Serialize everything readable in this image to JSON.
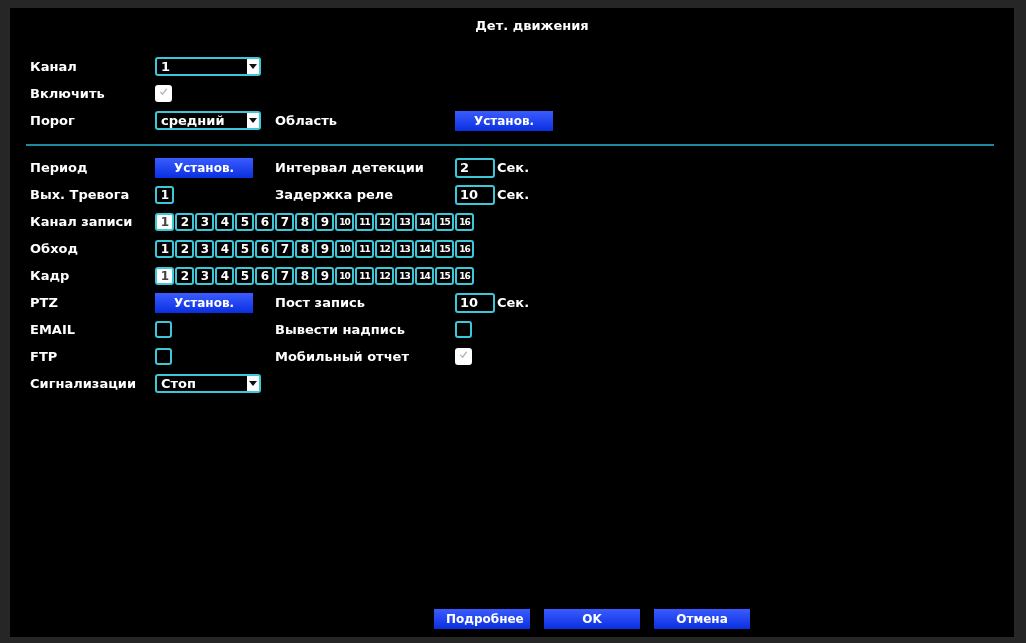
{
  "window": {
    "title": "Дет. движения"
  },
  "top_rows": [
    {
      "label": "Канал",
      "control": {
        "kind": "select",
        "value": "1"
      }
    },
    {
      "label": "Включить",
      "control": {
        "kind": "checkbox",
        "checked": true
      }
    },
    {
      "label": "Порог",
      "control": {
        "kind": "select",
        "value": "средний"
      },
      "right": {
        "label": "Область",
        "control": {
          "kind": "button",
          "label": "Установ."
        }
      }
    }
  ],
  "rows": [
    {
      "label": "Период",
      "control": {
        "kind": "button",
        "label": "Установ."
      },
      "right": {
        "label": "Интервал детекции",
        "control": {
          "kind": "number",
          "value": "2",
          "unit": "Сек."
        }
      }
    },
    {
      "label": "Вых. Тревога",
      "control": {
        "kind": "channels",
        "items": [
          {
            "label": "1",
            "selected": false
          }
        ]
      },
      "right": {
        "label": "Задержка реле",
        "control": {
          "kind": "number",
          "value": "10",
          "unit": "Сек."
        }
      }
    },
    {
      "label": "Канал записи",
      "control": {
        "kind": "channels",
        "items": [
          {
            "label": "1",
            "selected": true
          },
          {
            "label": "2",
            "selected": false
          },
          {
            "label": "3",
            "selected": false
          },
          {
            "label": "4",
            "selected": false
          },
          {
            "label": "5",
            "selected": false
          },
          {
            "label": "6",
            "selected": false
          },
          {
            "label": "7",
            "selected": false
          },
          {
            "label": "8",
            "selected": false
          },
          {
            "label": "9",
            "selected": false
          },
          {
            "label": "10",
            "selected": false
          },
          {
            "label": "11",
            "selected": false
          },
          {
            "label": "12",
            "selected": false
          },
          {
            "label": "13",
            "selected": false
          },
          {
            "label": "14",
            "selected": false
          },
          {
            "label": "15",
            "selected": false
          },
          {
            "label": "16",
            "selected": false
          }
        ]
      }
    },
    {
      "label": "Обход",
      "control": {
        "kind": "channels",
        "items": [
          {
            "label": "1",
            "selected": false
          },
          {
            "label": "2",
            "selected": false
          },
          {
            "label": "3",
            "selected": false
          },
          {
            "label": "4",
            "selected": false
          },
          {
            "label": "5",
            "selected": false
          },
          {
            "label": "6",
            "selected": false
          },
          {
            "label": "7",
            "selected": false
          },
          {
            "label": "8",
            "selected": false
          },
          {
            "label": "9",
            "selected": false
          },
          {
            "label": "10",
            "selected": false
          },
          {
            "label": "11",
            "selected": false
          },
          {
            "label": "12",
            "selected": false
          },
          {
            "label": "13",
            "selected": false
          },
          {
            "label": "14",
            "selected": false
          },
          {
            "label": "15",
            "selected": false
          },
          {
            "label": "16",
            "selected": false
          }
        ]
      }
    },
    {
      "label": "Кадр",
      "control": {
        "kind": "channels",
        "items": [
          {
            "label": "1",
            "selected": true
          },
          {
            "label": "2",
            "selected": false
          },
          {
            "label": "3",
            "selected": false
          },
          {
            "label": "4",
            "selected": false
          },
          {
            "label": "5",
            "selected": false
          },
          {
            "label": "6",
            "selected": false
          },
          {
            "label": "7",
            "selected": false
          },
          {
            "label": "8",
            "selected": false
          },
          {
            "label": "9",
            "selected": false
          },
          {
            "label": "10",
            "selected": false
          },
          {
            "label": "11",
            "selected": false
          },
          {
            "label": "12",
            "selected": false
          },
          {
            "label": "13",
            "selected": false
          },
          {
            "label": "14",
            "selected": false
          },
          {
            "label": "15",
            "selected": false
          },
          {
            "label": "16",
            "selected": false
          }
        ]
      }
    },
    {
      "label": "PTZ",
      "control": {
        "kind": "button",
        "label": "Установ."
      },
      "right": {
        "label": "Пост запись",
        "control": {
          "kind": "number",
          "value": "10",
          "unit": "Сек."
        }
      }
    },
    {
      "label": "EMAIL",
      "control": {
        "kind": "checkbox",
        "checked": false
      },
      "right": {
        "label": "Вывести надпись",
        "control": {
          "kind": "checkbox",
          "checked": false
        }
      }
    },
    {
      "label": "FTP",
      "control": {
        "kind": "checkbox",
        "checked": false
      },
      "right": {
        "label": "Мобильный отчет",
        "control": {
          "kind": "checkbox",
          "checked": true
        }
      }
    },
    {
      "label": "Сигнализации",
      "control": {
        "kind": "select",
        "value": "Стоп"
      }
    }
  ],
  "buttons": [
    "Подробнее",
    "OK",
    "Отмена"
  ]
}
